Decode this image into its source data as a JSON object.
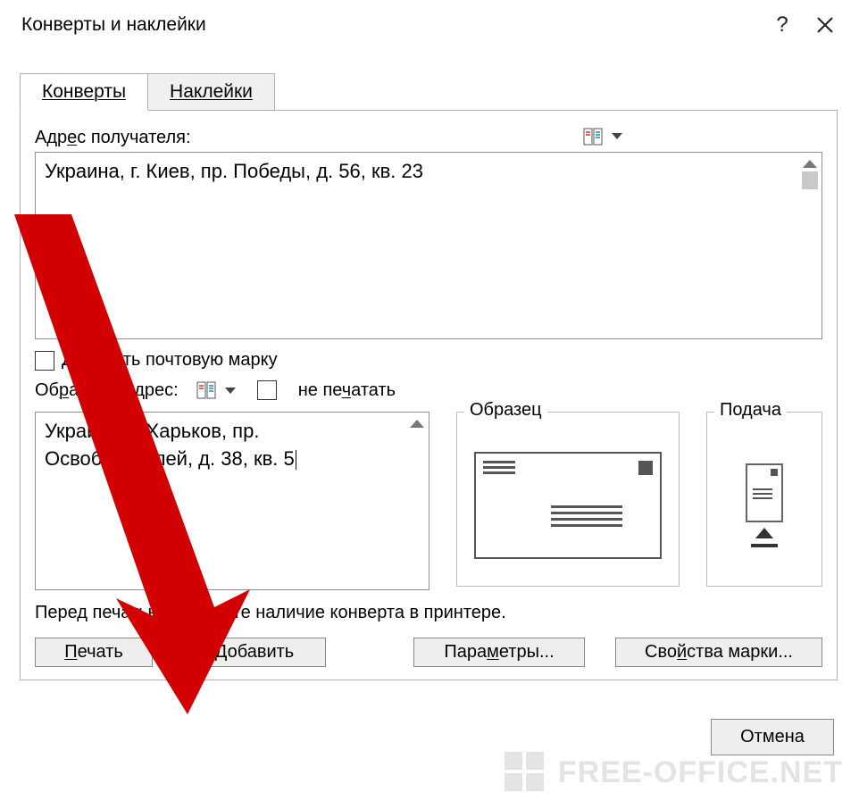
{
  "title": "Конверты и наклейки",
  "tabs": {
    "envelopes": "Конверты",
    "labels": "Наклейки"
  },
  "recipient": {
    "label": "Адрес получателя:",
    "underline": "е",
    "value": "Украина, г. Киев, пр. Победы, д. 56, кв. 23"
  },
  "add_stamp": {
    "label_pre": "Доба",
    "label_u": "в",
    "label_post": "ить почтовую марку"
  },
  "return_addr": {
    "label_pre": "Об",
    "label_u": "р",
    "label_post": "атный адрес:",
    "value": "Украина, г. Харьков, пр. Освободителей, д. 38, кв. 5"
  },
  "omit": {
    "label_pre": "не пе",
    "label_u": "ч",
    "label_post": "атать"
  },
  "sample": "Образец",
  "feed": "Подача",
  "hint": "Перед печатью проверьте наличие конверта в принтере.",
  "buttons": {
    "print_u": "П",
    "print_post": "ечать",
    "add_u": "Д",
    "add_post": "обавить",
    "params_pre": "Пара",
    "params_u": "м",
    "params_post": "етры...",
    "stamp_pre": "Сво",
    "stamp_u": "й",
    "stamp_post": "ства марки...",
    "cancel": "Отмена"
  },
  "watermark": "FREE-OFFICE.NET"
}
